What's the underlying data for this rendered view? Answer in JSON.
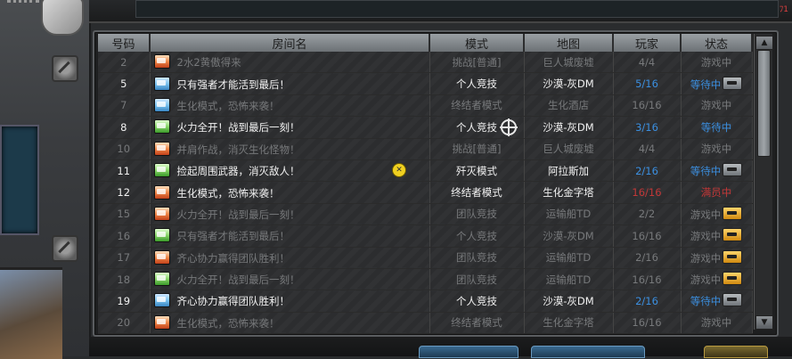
{
  "corner_text": "ﾌ1",
  "table": {
    "headers": [
      "号码",
      "房间名",
      "模式",
      "地图",
      "玩家",
      "状态"
    ],
    "rows": [
      {
        "no": "2",
        "name": "2水2黄傲得来",
        "mode": "挑战[普通]",
        "map": "巨人城废墟",
        "players": "4/4",
        "status": "游戏中",
        "icon": "red",
        "dim": true,
        "players_color": "",
        "status_color": "",
        "badge": ""
      },
      {
        "no": "5",
        "name": "只有强者才能活到最后！",
        "mode": "个人竞技",
        "map": "沙漠-灰DM",
        "players": "5/16",
        "status": "等待中",
        "icon": "blue",
        "dim": false,
        "players_color": "blue",
        "status_color": "blue",
        "badge": "gray"
      },
      {
        "no": "7",
        "name": "生化模式，恐怖来袭！",
        "mode": "终结者模式",
        "map": "生化酒店",
        "players": "16/16",
        "status": "游戏中",
        "icon": "blue",
        "dim": true,
        "players_color": "",
        "status_color": "",
        "badge": ""
      },
      {
        "no": "8",
        "name": "火力全开！战到最后一刻！",
        "mode": "个人竞技",
        "map": "沙漠-灰DM",
        "players": "3/16",
        "status": "等待中",
        "icon": "green",
        "dim": false,
        "players_color": "blue",
        "status_color": "blue",
        "badge": ""
      },
      {
        "no": "10",
        "name": "并肩作战，消灭生化怪物！",
        "mode": "挑战[普通]",
        "map": "巨人城废墟",
        "players": "4/4",
        "status": "游戏中",
        "icon": "red",
        "dim": true,
        "players_color": "",
        "status_color": "",
        "badge": ""
      },
      {
        "no": "11",
        "name": "捡起周围武器，消灭敌人！",
        "mode": "歼灭模式",
        "map": "阿拉斯加",
        "players": "2/16",
        "status": "等待中",
        "icon": "green",
        "dim": false,
        "players_color": "blue",
        "status_color": "blue",
        "badge": "gray"
      },
      {
        "no": "12",
        "name": "生化模式，恐怖来袭！",
        "mode": "终结者模式",
        "map": "生化金字塔",
        "players": "16/16",
        "status": "满员中",
        "icon": "red",
        "dim": false,
        "players_color": "red",
        "status_color": "red",
        "badge": ""
      },
      {
        "no": "15",
        "name": "火力全开！战到最后一刻！",
        "mode": "团队竞技",
        "map": "运输船TD",
        "players": "2/2",
        "status": "游戏中",
        "icon": "red",
        "dim": true,
        "players_color": "",
        "status_color": "",
        "badge": "gold"
      },
      {
        "no": "16",
        "name": "只有强者才能活到最后！",
        "mode": "个人竞技",
        "map": "沙漠-灰DM",
        "players": "16/16",
        "status": "游戏中",
        "icon": "green",
        "dim": true,
        "players_color": "",
        "status_color": "",
        "badge": "gold"
      },
      {
        "no": "17",
        "name": "齐心协力赢得团队胜利！",
        "mode": "团队竞技",
        "map": "运输船TD",
        "players": "2/16",
        "status": "游戏中",
        "icon": "red",
        "dim": true,
        "players_color": "",
        "status_color": "",
        "badge": "gold"
      },
      {
        "no": "18",
        "name": "火力全开！战到最后一刻！",
        "mode": "团队竞技",
        "map": "运输船TD",
        "players": "16/16",
        "status": "游戏中",
        "icon": "green",
        "dim": true,
        "players_color": "",
        "status_color": "",
        "badge": "gold"
      },
      {
        "no": "19",
        "name": "齐心协力赢得团队胜利！",
        "mode": "个人竞技",
        "map": "沙漠-灰DM",
        "players": "2/16",
        "status": "等待中",
        "icon": "blue",
        "dim": false,
        "players_color": "blue",
        "status_color": "blue",
        "badge": "gray"
      },
      {
        "no": "20",
        "name": "生化模式，恐怖来袭！",
        "mode": "终结者模式",
        "map": "生化金字塔",
        "players": "16/16",
        "status": "游戏中",
        "icon": "red",
        "dim": true,
        "players_color": "",
        "status_color": "",
        "badge": ""
      }
    ]
  },
  "scrollbar": {
    "up": "▲",
    "down": "▼"
  },
  "marker_glyph": "✕"
}
